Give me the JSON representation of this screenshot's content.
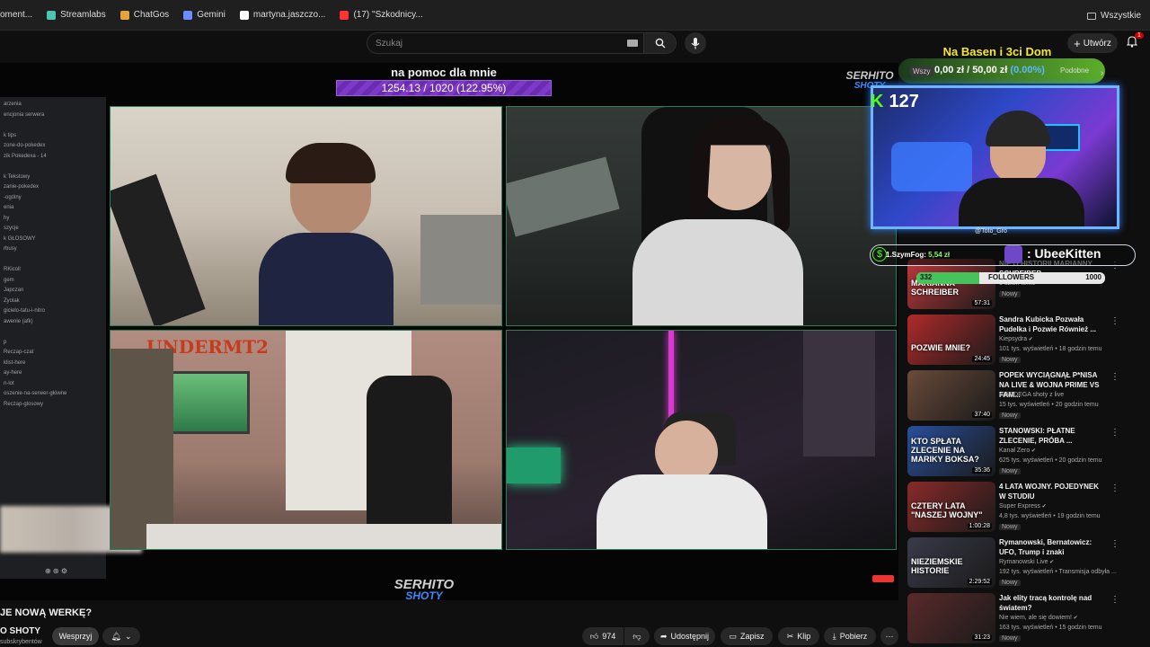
{
  "bookmarks": [
    {
      "label": "oment...",
      "icon": ""
    },
    {
      "label": "Streamlabs",
      "icon": "#4bc6b1"
    },
    {
      "label": "ChatGos",
      "icon": "#e8a23a"
    },
    {
      "label": "Gemini",
      "icon": "#6c8cff"
    },
    {
      "label": "martyna.jaszczo...",
      "icon": "#ffffff"
    },
    {
      "label": "(17) \"Szkodnicy...",
      "icon": "#ff3333"
    }
  ],
  "bookmarks_all": "Wszystkie",
  "search": {
    "placeholder": "Szukaj"
  },
  "create_label": "Utwórz",
  "notif_count": "1",
  "goal": {
    "title": "na pomoc dla mnie",
    "value": "1254.13 / 1020 (122.95%)"
  },
  "discord_lines": [
    "arzenia",
    "encjonia serwera",
    "",
    "k tips",
    "zone-do-pokedex",
    "zik Pokedexa - 14",
    "",
    "k Tekstowy",
    "zanie-pokedex",
    "-ogólny",
    "enia",
    "hy",
    "szycje",
    "k GŁOSOWY",
    "rbusy",
    "",
    "RKicoll",
    "gem",
    "Japczan",
    "Zyolak",
    "gicielo-tatu-i-nitro",
    "awenie (afk)",
    "",
    "p",
    "Reczap-czat",
    "klist-here",
    "ay-here",
    "n-lot",
    "oszenie-na-serwer-główne",
    "Reczap-glosowy"
  ],
  "serhito_top": {
    "line1": "SERHITO",
    "line2": "SHOTY"
  },
  "serhito_bottom": {
    "line1": "SERHITO",
    "line2": "SHOTY"
  },
  "cam_text_under": "UNDERMT2",
  "alert": {
    "title": "Na Basen i 3ci Dom",
    "amount": "0,00 zł / 50,00 zł",
    "percent": "(0.00%)",
    "bg_tag": "Wszy",
    "bg_tag2": "Podobne"
  },
  "kick": {
    "viewers": "127"
  },
  "webcam_name": "@Toto_Gro",
  "donor": {
    "name": "1.SzymFog:",
    "amount": "5,54 zł",
    "sub_name": ": UbeeKitten"
  },
  "followers": {
    "current": "332",
    "label": "FOLLOWERS",
    "goal": "1000",
    "fraction": 0.332
  },
  "recommendations": [
    {
      "title": "NIE O HISTORII MARIANNY SCHREIBER",
      "channel": "",
      "views": "1 dzień temu",
      "duration": "57:31",
      "badge": "Nowy",
      "thumb": "#c0373b",
      "thumb_text": "MARIANNA SCHREIBER",
      "verified": false
    },
    {
      "title": "Sandra Kubicka Pozwała Pudelka i Pozwie Również ...",
      "channel": "Kiepsydra",
      "views": "101 tys. wyświetleń • 18 godzin temu",
      "duration": "24:45",
      "badge": "Nowy",
      "thumb": "#b02a2a",
      "thumb_text": "POZWIE MNIE?",
      "verified": true
    },
    {
      "title": "POPEK WYCIĄGNĄŁ P*NISA NA LIVE & WOJNA PRIME VS FAM...",
      "channel": "WARDEGA shoty z live",
      "views": "15 tys. wyświetleń • 20 godzin temu",
      "duration": "37:40",
      "badge": "Nowy",
      "thumb": "#6a4b3a",
      "thumb_text": "",
      "verified": false
    },
    {
      "title": "STANOWSKI: PŁATNE ZLECENIE, PRÓBA ...",
      "channel": "Kanał Zero",
      "views": "625 tys. wyświetleń • 20 godzin temu",
      "duration": "35:36",
      "badge": "Nowy",
      "thumb": "#2a4f9b",
      "thumb_text": "KTO SPŁATA ZLECENIE NA MARIKY BOKSA?",
      "verified": true
    },
    {
      "title": "4 LATA WOJNY. POJEDYNEK W STUDIU",
      "channel": "Super Express",
      "views": "4,8 tys. wyświetleń • 19 godzin temu",
      "duration": "1:00:28",
      "badge": "Nowy",
      "thumb": "#8a2a2a",
      "thumb_text": "CZTERY LATA \"NASZEJ WOJNY\"",
      "verified": true
    },
    {
      "title": "Rymanowski, Bernatowicz: UFO, Trump i znaki",
      "channel": "Rymanowski Live",
      "views": "192 tys. wyświetleń • Transmisja odbyła ...",
      "duration": "2:29:52",
      "badge": "Nowy",
      "thumb": "#3a3a4a",
      "thumb_text": "NIEZIEMSKIE HISTORIE",
      "verified": true
    },
    {
      "title": "Jak elity tracą kontrolę nad światem?",
      "channel": "Nie wiem, ale się dowiem!",
      "views": "163 tys. wyświetleń • 15 godzin temu",
      "duration": "31:23",
      "badge": "Nowy",
      "thumb": "#5a2a2a",
      "thumb_text": "",
      "verified": true
    }
  ],
  "video": {
    "title": "JE NOWĄ WERKĘ?",
    "channel": "O SHOTY",
    "subs": "subskrybentów",
    "support_label": "Wesprzyj"
  },
  "actions": {
    "likes": "974",
    "share": "Udostępnij",
    "save": "Zapisz",
    "clip": "Klip",
    "download": "Pobierz"
  }
}
